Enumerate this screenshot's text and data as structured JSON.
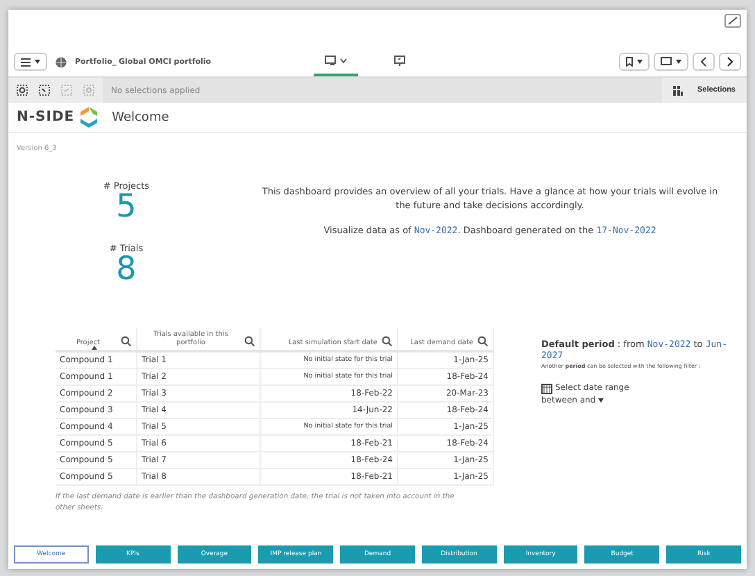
{
  "toolbar": {
    "app_title": "Portfolio_ Global OMCI portfolio",
    "view_tabs": [
      {
        "kind": "sheet",
        "selected": true
      },
      {
        "kind": "present",
        "selected": false
      }
    ]
  },
  "selection_bar": {
    "status": "No selections applied",
    "selections_label": "Selections"
  },
  "header": {
    "logo_text": "N-SIDE",
    "title": "Welcome"
  },
  "version": "Version 6_3",
  "kpis": [
    {
      "label": "# Projects",
      "value": "5"
    },
    {
      "label": "# Trials",
      "value": "8"
    }
  ],
  "intro": "This dashboard provides an overview of all your trials. Have a glance at how your trials will evolve in the future and take decisions accordingly.",
  "visualize": [
    {
      "kind": "text",
      "text": "Visualize data as of "
    },
    {
      "kind": "date",
      "text": "Nov-2022"
    },
    {
      "kind": "text",
      "text": ". Dashboard generated on the "
    },
    {
      "kind": "date",
      "text": "17-Nov-2022"
    }
  ],
  "table": {
    "columns": [
      {
        "label": "Project",
        "sorted": true
      },
      {
        "label": "Trials available in this portfolio",
        "sorted": false
      },
      {
        "label": "Last simulation start date",
        "sorted": false
      },
      {
        "label": "Last demand date",
        "sorted": false
      }
    ],
    "rows": [
      [
        "Compound 1",
        "Trial 1",
        "No initial state for this trial",
        "1-Jan-25"
      ],
      [
        "Compound 1",
        "Trial 2",
        "No initial state for this trial",
        "18-Feb-24"
      ],
      [
        "Compound 2",
        "Trial 3",
        "18-Feb-22",
        "20-Mar-23"
      ],
      [
        "Compound 3",
        "Trial 4",
        "14-Jun-22",
        "18-Feb-24"
      ],
      [
        "Compound 4",
        "Trial 5",
        "No initial state for this trial",
        "1-Jan-25"
      ],
      [
        "Compound 5",
        "Trial 6",
        "18-Feb-21",
        "18-Feb-24"
      ],
      [
        "Compound 5",
        "Trial 7",
        "18-Feb-24",
        "1-Jan-25"
      ],
      [
        "Compound 5",
        "Trial 8",
        "18-Feb-21",
        "1-Jan-25"
      ]
    ],
    "footnote": "If the last demand date is earlier than the dashboard generation date, the trial is not taken into account in the other sheets."
  },
  "period": {
    "parts": [
      {
        "kind": "bold",
        "text": "Default period"
      },
      {
        "kind": "text",
        "text": " : from "
      },
      {
        "kind": "date",
        "text": "Nov-2022"
      },
      {
        "kind": "text",
        "text": " to "
      },
      {
        "kind": "date",
        "text": "Jun-2027"
      }
    ],
    "note": "Another **period** can be selected with the following filter :",
    "filter_label": "Select date range",
    "filter_value": "between and"
  },
  "nav_tabs": [
    {
      "label": "Welcome",
      "selected": true
    },
    {
      "label": "KPIs",
      "selected": false
    },
    {
      "label": "Overage",
      "selected": false
    },
    {
      "label": "IMP release plan",
      "selected": false
    },
    {
      "label": "Demand",
      "selected": false
    },
    {
      "label": "Distribution",
      "selected": false
    },
    {
      "label": "Inventory",
      "selected": false
    },
    {
      "label": "Budget",
      "selected": false
    },
    {
      "label": "Risk",
      "selected": false
    }
  ]
}
